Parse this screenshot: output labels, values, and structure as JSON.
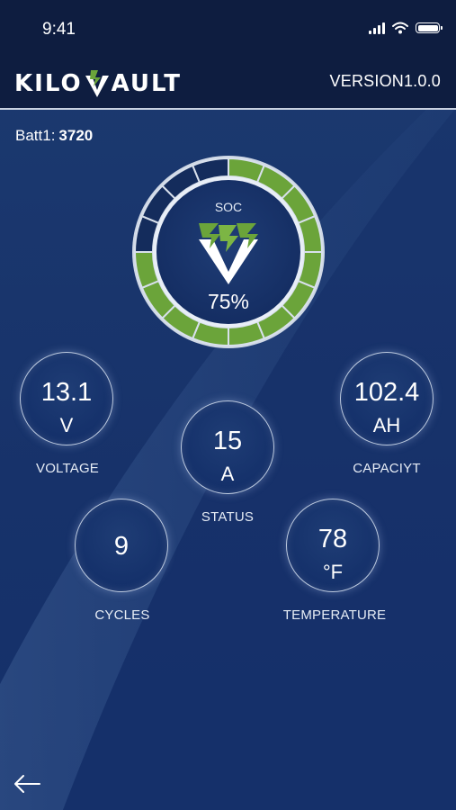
{
  "status_bar": {
    "time": "9:41"
  },
  "header": {
    "logo_text_left": "KILO",
    "logo_text_right": "AULT",
    "version": "VERSION1.0.0"
  },
  "battery": {
    "label": "Batt1:",
    "id": "3720"
  },
  "soc": {
    "label": "SOC",
    "value": "75%",
    "fraction": 0.75,
    "segments_total": 16,
    "segments_filled": 12
  },
  "metrics": {
    "voltage": {
      "value": "13.1",
      "unit": "V",
      "label": "VOLTAGE"
    },
    "capacity": {
      "value": "102.4",
      "unit": "AH",
      "label": "CAPACIYT"
    },
    "status": {
      "value": "15",
      "unit": "A",
      "label": "STATUS"
    },
    "cycles": {
      "value": "9",
      "label": "CYCLES"
    },
    "temperature": {
      "value": "78",
      "unit": "°F",
      "label": "TEMPERATURE"
    }
  },
  "icons": {
    "back": "arrow-left-icon",
    "signal": "cellular-signal-icon",
    "wifi": "wifi-icon",
    "battery": "battery-icon"
  },
  "colors": {
    "background": "#163266",
    "header": "#0e1d40",
    "gauge_filled": "#6ba43a",
    "gauge_empty": "#142c5c",
    "text": "#ffffff"
  }
}
